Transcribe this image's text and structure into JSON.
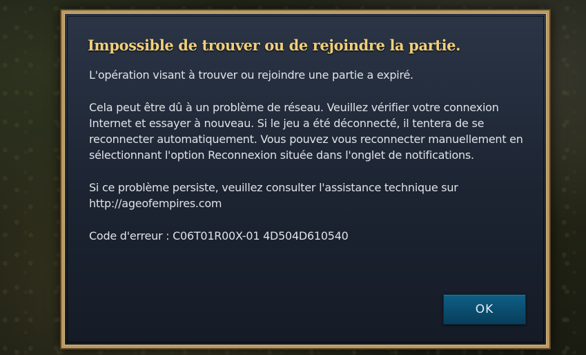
{
  "dialog": {
    "title": "Impossible de trouver ou de rejoindre la partie.",
    "paragraphs": [
      "L'opération visant à trouver ou rejoindre une partie a expiré.",
      "Cela peut être dû à un problème de réseau. Veuillez vérifier votre connexion Internet et essayer à nouveau. Si le jeu a été déconnecté, il tentera de se reconnecter automatiquement. Vous pouvez vous reconnecter manuellement en sélectionnant l'option Reconnexion située dans l'onglet de notifications.",
      "Si ce problème persiste, veuillez consulter l'assistance technique sur http://ageofempires.com",
      "Code d'erreur : C06T01R00X-01 4D504D610540"
    ],
    "ok_label": "OK"
  },
  "colors": {
    "title": "#f0cf7a",
    "frame": "#b99a63",
    "panel": "#1c2432",
    "button": "#0a4b6c"
  }
}
